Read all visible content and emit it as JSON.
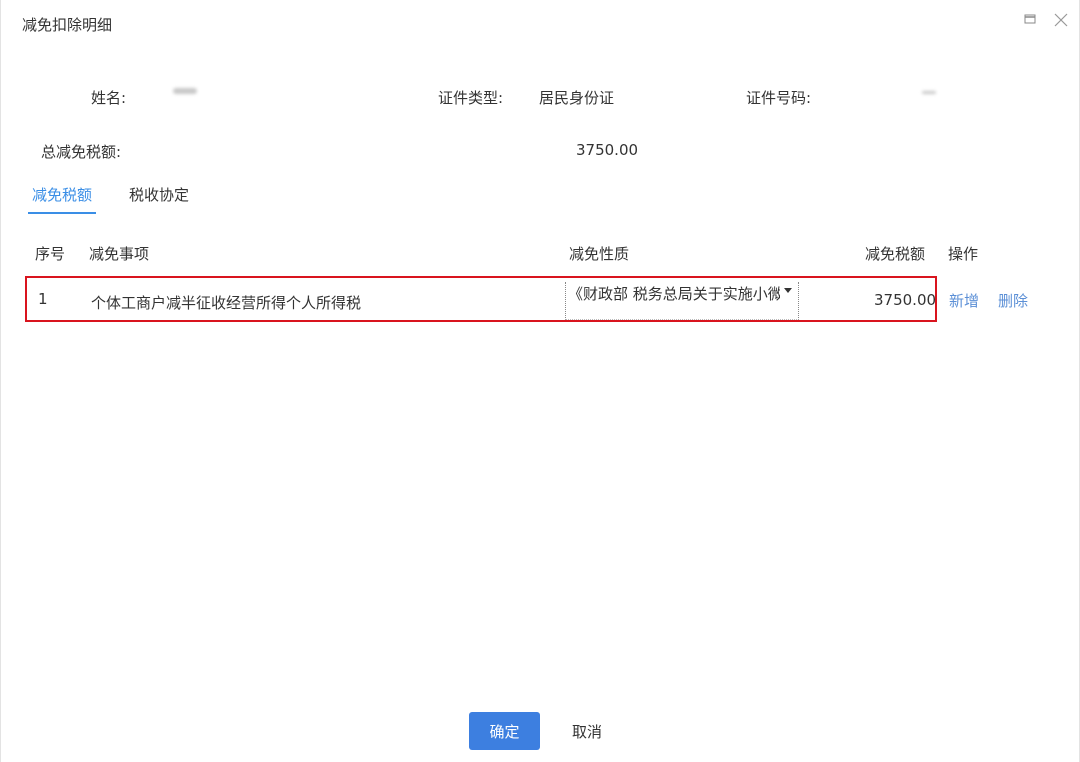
{
  "dialog": {
    "title": "减免扣除明细"
  },
  "info": {
    "name_label": "姓名:",
    "id_type_label": "证件类型:",
    "id_type_value": "居民身份证",
    "id_number_label": "证件号码:",
    "total_label": "总减免税额:",
    "total_value": "3750.00"
  },
  "tabs": [
    {
      "label": "减免税额",
      "active": true
    },
    {
      "label": "税收协定",
      "active": false
    }
  ],
  "table": {
    "headers": [
      "序号",
      "减免事项",
      "减免性质",
      "减免税额",
      "操作"
    ],
    "rows": [
      {
        "index": "1",
        "item": "个体工商户减半征收经营所得个人所得税",
        "nature": "《财政部 税务总局关于实施小微企业和个体工商户所得税优惠政策的公告》",
        "amount": "3750.00",
        "actions": [
          "新增",
          "删除"
        ]
      }
    ]
  },
  "footer": {
    "confirm_label": "确定",
    "cancel_label": "取消"
  },
  "colors": {
    "accent": "#3d7fe0",
    "link": "#5b8fd6",
    "highlight_border": "#d9141e"
  },
  "icons": {
    "restore": "restore-icon",
    "close": "close-icon",
    "dropdown": "caret-down-icon"
  }
}
